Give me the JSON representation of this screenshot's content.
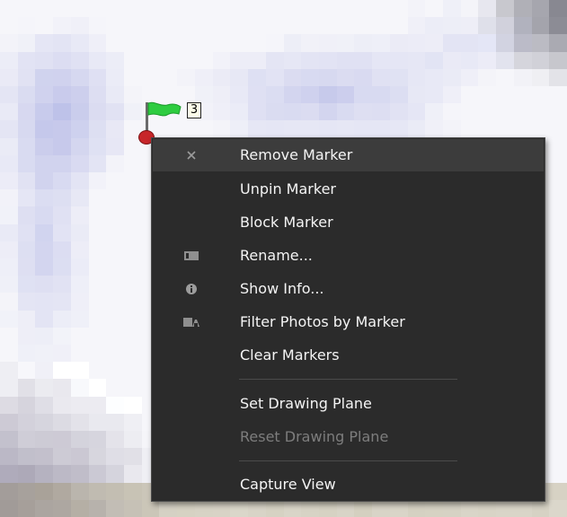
{
  "map": {
    "description_color": "#b8b8dc",
    "marker": {
      "flag_color": "#2ecc40",
      "pin_color": "#c7262a",
      "count_label": "3"
    }
  },
  "context_menu": {
    "items": [
      {
        "label": "Remove Marker",
        "icon": "close-icon",
        "state": "highlighted"
      },
      {
        "label": "Unpin Marker",
        "icon": "",
        "state": "enabled"
      },
      {
        "label": "Block Marker",
        "icon": "",
        "state": "enabled"
      },
      {
        "label": "Rename...",
        "icon": "rename-icon",
        "state": "enabled"
      },
      {
        "label": "Show Info...",
        "icon": "info-icon",
        "state": "enabled"
      },
      {
        "label": "Filter Photos by Marker",
        "icon": "filter-photos-icon",
        "state": "enabled"
      },
      {
        "label": "Clear Markers",
        "icon": "",
        "state": "enabled"
      },
      {
        "label": "Set Drawing Plane",
        "icon": "",
        "state": "enabled"
      },
      {
        "label": "Reset Drawing Plane",
        "icon": "",
        "state": "disabled"
      },
      {
        "label": "Capture View",
        "icon": "",
        "state": "enabled"
      }
    ],
    "colors": {
      "background": "#2b2b2b",
      "highlight": "#3c3c3c",
      "text": "#f4f4f4",
      "disabled_text": "#7d7d7d"
    }
  }
}
